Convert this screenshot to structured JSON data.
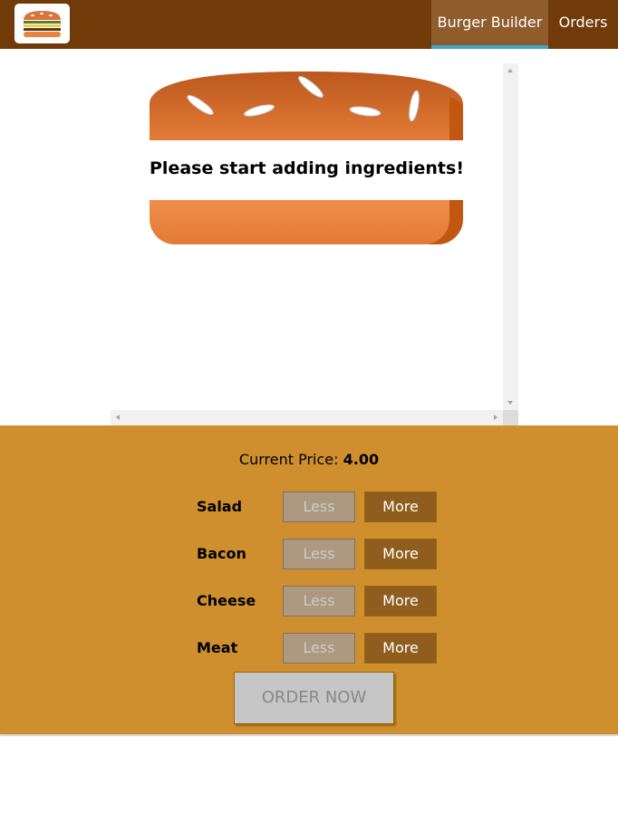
{
  "toolbar": {
    "logo_icon": "burger-logo-icon",
    "nav": [
      {
        "label": "Burger Builder",
        "active": true
      },
      {
        "label": "Orders",
        "active": false
      }
    ]
  },
  "burger": {
    "empty_message": "Please start adding ingredients!"
  },
  "build_controls": {
    "price_label": "Current Price:",
    "price_value": "4.00",
    "controls": [
      {
        "label": "Salad",
        "less": "Less",
        "more": "More"
      },
      {
        "label": "Bacon",
        "less": "Less",
        "more": "More"
      },
      {
        "label": "Cheese",
        "less": "Less",
        "more": "More"
      },
      {
        "label": "Meat",
        "less": "Less",
        "more": "More"
      }
    ],
    "order_button": "ORDER NOW"
  },
  "colors": {
    "toolbar": "#703b09",
    "active_nav": "#8f5c2c",
    "active_underline": "#40a4c8",
    "controls_bg": "#cf8f2e",
    "more_button": "#8f5e1e",
    "less_button_disabled": "#ac9980"
  }
}
